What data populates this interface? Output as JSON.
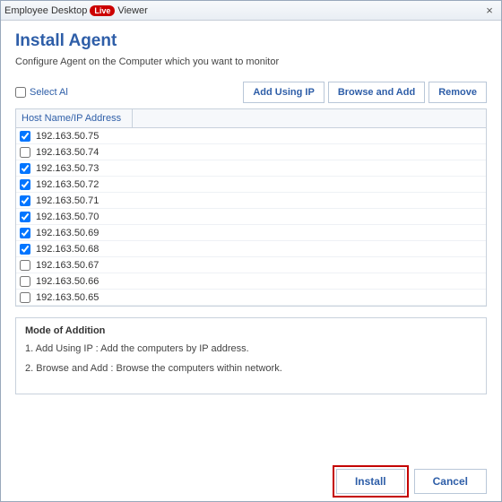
{
  "titlebar": {
    "prefix": "Employee Desktop",
    "badge": "Live",
    "suffix": "Viewer"
  },
  "page": {
    "title": "Install Agent",
    "subtitle": "Configure Agent on the Computer which you want to monitor"
  },
  "selectAll": {
    "label": "Select Al"
  },
  "toolbar": {
    "addIp": "Add Using IP",
    "browse": "Browse and Add",
    "remove": "Remove"
  },
  "table": {
    "header": "Host Name/IP Address",
    "rows": [
      {
        "ip": "192.163.50.75",
        "checked": true
      },
      {
        "ip": "192.163.50.74",
        "checked": false
      },
      {
        "ip": "192.163.50.73",
        "checked": true
      },
      {
        "ip": "192.163.50.72",
        "checked": true
      },
      {
        "ip": "192.163.50.71",
        "checked": true
      },
      {
        "ip": "192.163.50.70",
        "checked": true
      },
      {
        "ip": "192.163.50.69",
        "checked": true
      },
      {
        "ip": "192.163.50.68",
        "checked": true
      },
      {
        "ip": "192.163.50.67",
        "checked": false
      },
      {
        "ip": "192.163.50.66",
        "checked": false
      },
      {
        "ip": "192.163.50.65",
        "checked": false
      }
    ]
  },
  "mode": {
    "title": "Mode of Addition",
    "line1": "1. Add Using IP :    Add the computers by IP address.",
    "line2": "2. Browse and Add : Browse the computers within network."
  },
  "footer": {
    "install": "Install",
    "cancel": "Cancel"
  }
}
